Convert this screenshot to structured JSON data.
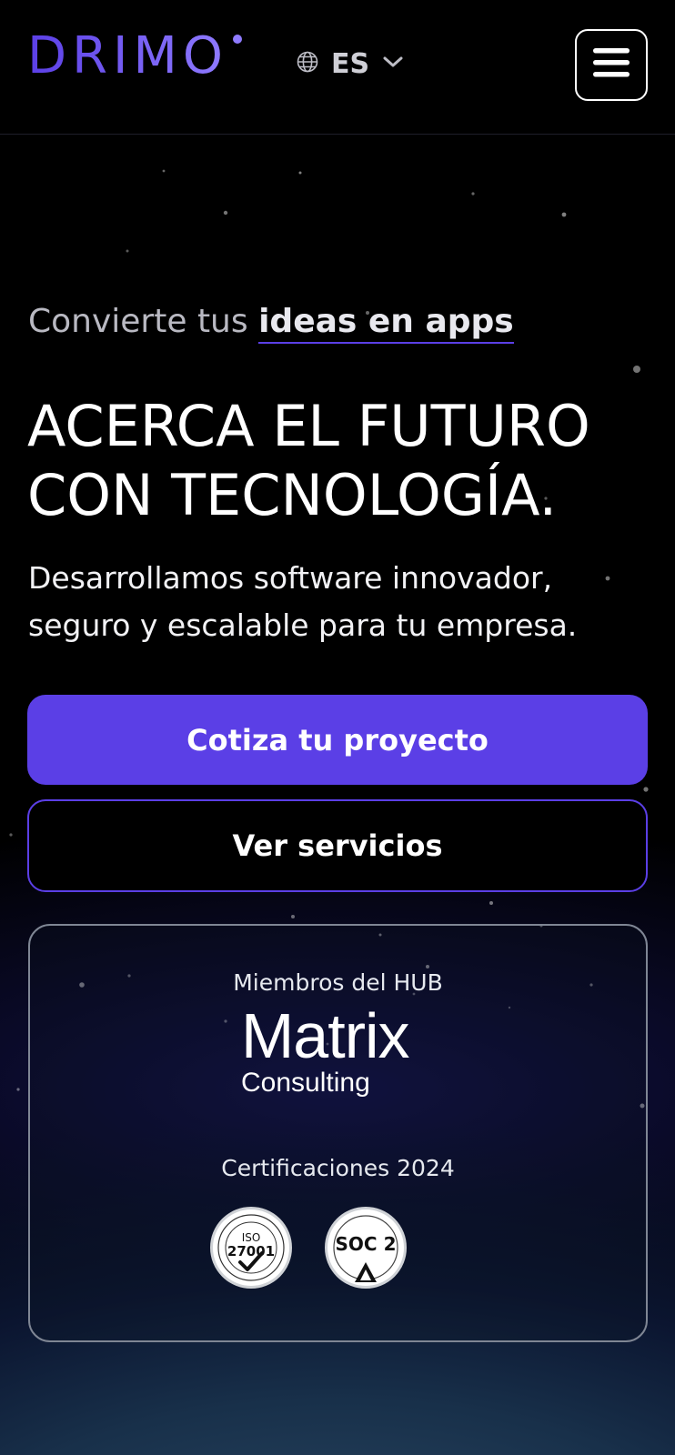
{
  "brand": {
    "logo_text": "DRIMO",
    "accent": "#5b3fe6"
  },
  "header": {
    "language": "ES",
    "language_icon": "globe-icon",
    "dropdown_icon": "chevron-down-icon",
    "menu_icon": "hamburger-menu-icon"
  },
  "hero": {
    "eyebrow_prefix": "Convierte tus",
    "eyebrow_highlight": "ideas en apps",
    "headline_line1": "ACERCA EL FUTURO",
    "headline_line2": "CON TECNOLOGÍA.",
    "subtext_line1": "Desarrollamos software innovador,",
    "subtext_line2": "seguro y escalable para tu empresa.",
    "primary_cta": "Cotiza tu proyecto",
    "secondary_cta": "Ver servicios"
  },
  "trust_card": {
    "members_label": "Miembros del HUB",
    "partner_name": "Matrix",
    "partner_sub": "Consulting",
    "certifications_label": "Certificaciones 2024",
    "badges": [
      {
        "label": "ISO",
        "number": "27001"
      },
      {
        "label": "SOC 2"
      }
    ]
  }
}
